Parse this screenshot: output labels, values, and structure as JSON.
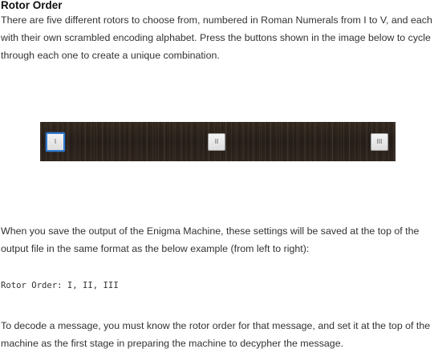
{
  "section": {
    "title": "Rotor Order",
    "intro": "There are five different rotors to choose from, numbered in Roman Numerals from I to V, and each with their own scrambled encoding alphabet. Press the buttons shown in the image below to cycle through each one to create a unique combination.",
    "save_note": "When you save the output of the Enigma Machine, these settings will be saved at the top of the output file in the same format as the below example (from left to right):",
    "example": "Rotor Order: I, II, III",
    "decode_note": "To decode a message, you must know the rotor order for that message, and set it at the top of the machine as the first stage in preparing the machine to decypher the message."
  },
  "rotor_bar": {
    "buttons": [
      {
        "label": "I",
        "selected": true
      },
      {
        "label": "II",
        "selected": false
      },
      {
        "label": "III",
        "selected": false
      }
    ],
    "accent": "#2f7bd1",
    "background": "#2a221d"
  }
}
